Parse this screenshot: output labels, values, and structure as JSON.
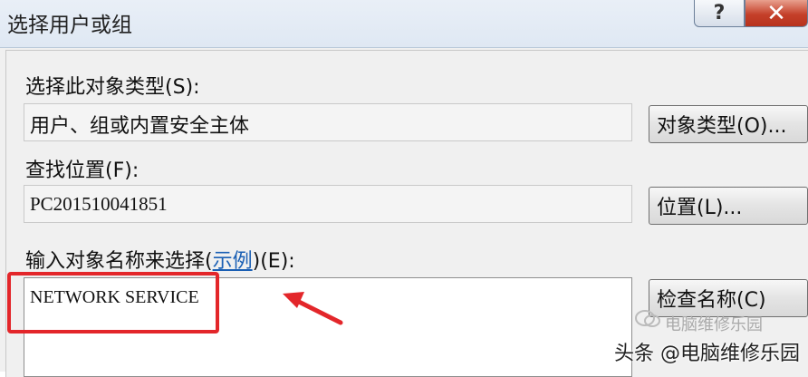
{
  "window": {
    "title": "选择用户或组",
    "help_label": "?",
    "close_label": "✕"
  },
  "object_type": {
    "label_prefix": "选择此对象类型",
    "label_key": "(S)",
    "label_suffix": ":",
    "value": "用户、组或内置安全主体",
    "button_label": "对象类型(O)..."
  },
  "location": {
    "label_prefix": "查找位置",
    "label_key": "(F)",
    "label_suffix": ":",
    "value": "PC201510041851",
    "button_label": "位置(L)..."
  },
  "object_names": {
    "label_prefix": "输入对象名称来选择",
    "link_open": "(",
    "link_text": "示例",
    "link_close": ")",
    "label_key": "(E)",
    "label_suffix": ":",
    "value": "NETWORK SERVICE",
    "button_label": "检查名称(C)"
  },
  "watermark": {
    "text": "头条 @电脑维修乐园",
    "logo_text": "电脑维修乐园"
  },
  "colors": {
    "highlight": "#e3262a",
    "arrow": "#e3262a",
    "link": "#1a5fb4"
  }
}
